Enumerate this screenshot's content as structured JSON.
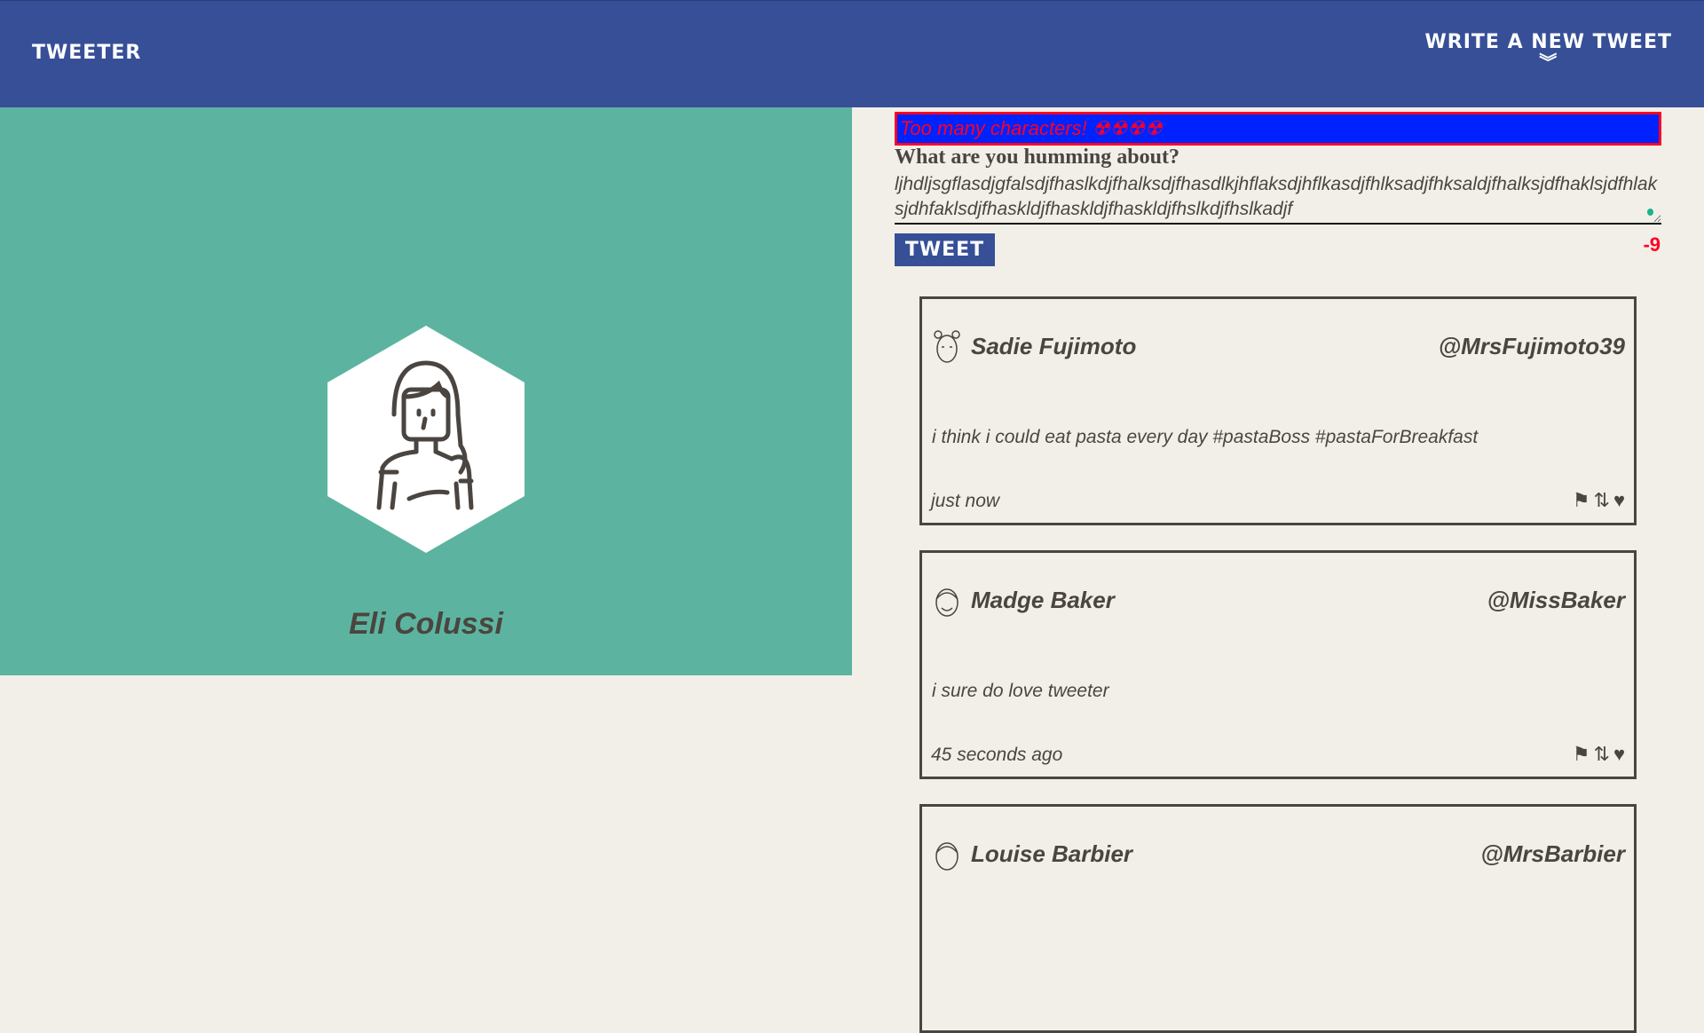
{
  "nav": {
    "brand": "TWEETER",
    "compose_label": "WRITE A NEW TWEET",
    "compose_icon": "double-chevron-down-icon"
  },
  "profile": {
    "name": "Eli Colussi"
  },
  "composer": {
    "error": "Too many characters! ☢☢☢☢",
    "label": "What are you humming about?",
    "text": "ljhdljsgflasdjgfalsdjfhaslkdjfhalksdjfhasdlkjhflaksdjhflkasdjfhlksadjfhksaldjfhalksjdfhaklsjdfhlaksjdhfaklsdjfhaskldjfhaskldjfhaskldjfhslkdjfhslkadjf",
    "button": "TWEET",
    "counter": "-9",
    "colors": {
      "error_bg": "#0022ff",
      "error_text": "#ff0022"
    }
  },
  "tweets": [
    {
      "name": "Sadie Fujimoto",
      "handle": "@MrsFujimoto39",
      "text": "i think i could eat pasta every day #pastaBoss #pastaForBreakfast",
      "time": "just now"
    },
    {
      "name": "Madge Baker",
      "handle": "@MissBaker",
      "text": "i sure do love tweeter",
      "time": "45 seconds ago"
    },
    {
      "name": "Louise Barbier",
      "handle": "@MrsBarbier",
      "text": "",
      "time": ""
    }
  ]
}
